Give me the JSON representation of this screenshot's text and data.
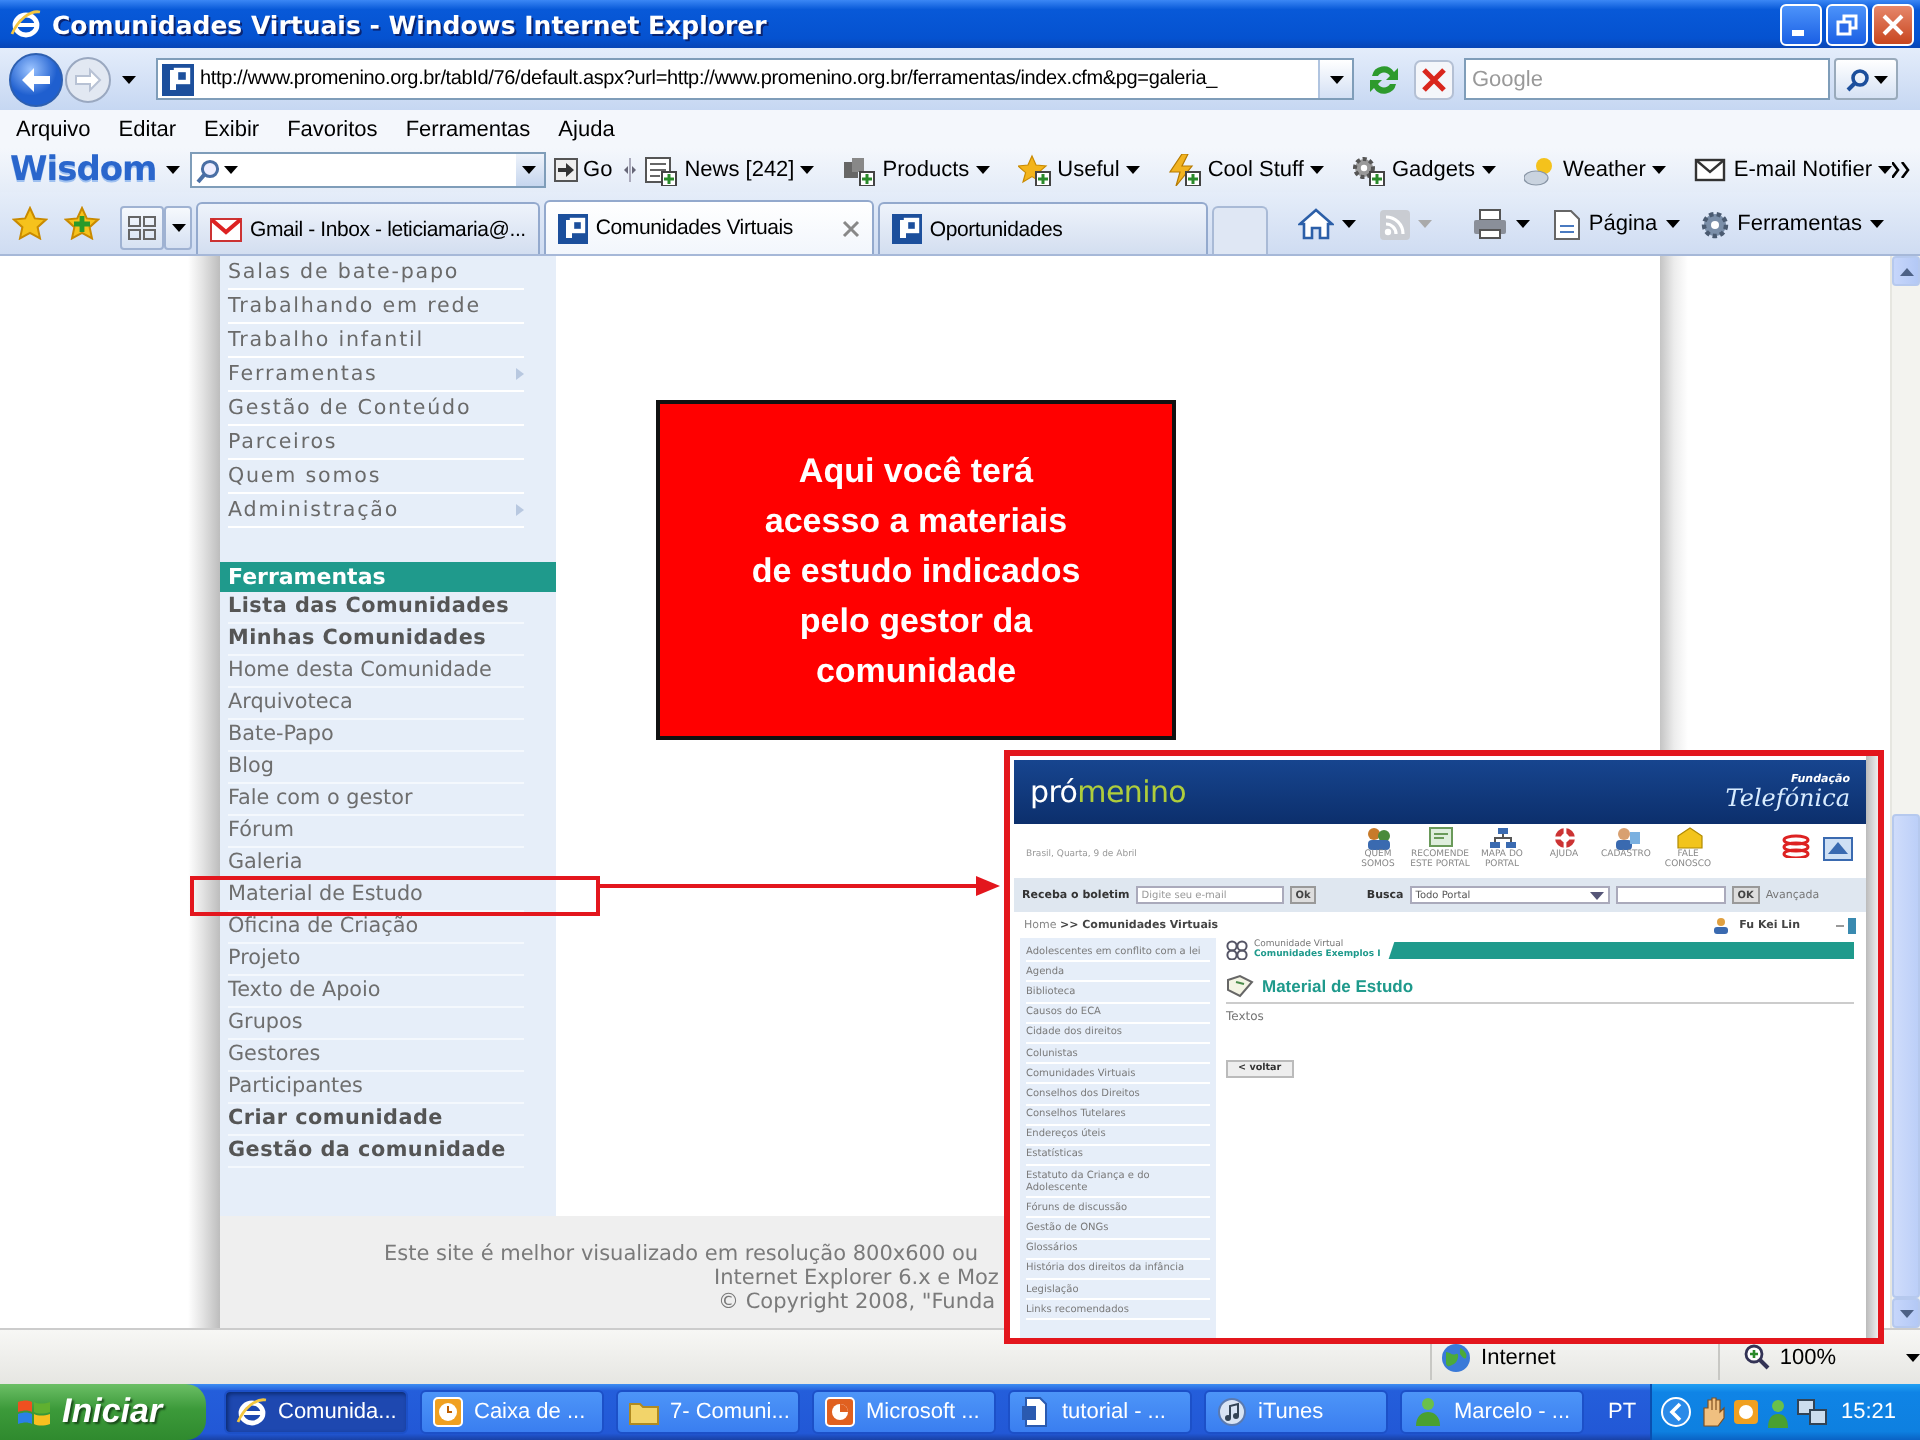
{
  "window": {
    "title": "Comunidades Virtuais - Windows Internet Explorer"
  },
  "address_bar": {
    "url": "http://www.promenino.org.br/tabId/76/default.aspx?url=http://www.promenino.org.br/ferramentas/index.cfm&pg=galeria_",
    "search_placeholder": "Google"
  },
  "menu_bar": [
    "Arquivo",
    "Editar",
    "Exibir",
    "Favoritos",
    "Ferramentas",
    "Ajuda"
  ],
  "toolbar": {
    "brand": "Wisdom",
    "go": "Go",
    "items": [
      "News [242]",
      "Products",
      "Useful",
      "Cool Stuff",
      "Gadgets",
      "Weather",
      "E-mail Notifier"
    ]
  },
  "tabs": [
    {
      "label": "Gmail - Inbox - leticiamaria@...",
      "selected": false
    },
    {
      "label": "Comunidades Virtuais",
      "selected": true
    },
    {
      "label": "Oportunidades",
      "selected": false
    }
  ],
  "command_bar": [
    "Página",
    "Ferramentas"
  ],
  "page": {
    "sidebar_links": [
      {
        "label": "Salas de bate-papo",
        "submenu": false
      },
      {
        "label": "Trabalhando em rede",
        "submenu": false
      },
      {
        "label": "Trabalho infantil",
        "submenu": false
      },
      {
        "label": "Ferramentas",
        "submenu": true
      },
      {
        "label": "Gestão de Conteúdo",
        "submenu": false
      },
      {
        "label": "Parceiros",
        "submenu": false
      },
      {
        "label": "Quem somos",
        "submenu": false
      },
      {
        "label": "Administração",
        "submenu": true
      }
    ],
    "section": {
      "title": "Ferramentas",
      "items": [
        {
          "label": "Lista das Comunidades",
          "bold": true,
          "highlighted": false
        },
        {
          "label": "Minhas Comunidades",
          "bold": true,
          "highlighted": false
        },
        {
          "label": "Home desta Comunidade",
          "bold": false,
          "highlighted": false
        },
        {
          "label": "Arquivoteca",
          "bold": false,
          "highlighted": false
        },
        {
          "label": "Bate-Papo",
          "bold": false,
          "highlighted": false
        },
        {
          "label": "Blog",
          "bold": false,
          "highlighted": false
        },
        {
          "label": "Fale com o gestor",
          "bold": false,
          "highlighted": false
        },
        {
          "label": "Fórum",
          "bold": false,
          "highlighted": false
        },
        {
          "label": "Galeria",
          "bold": false,
          "highlighted": false
        },
        {
          "label": "Material de Estudo",
          "bold": false,
          "highlighted": true
        },
        {
          "label": "Oficina de Criação",
          "bold": false,
          "highlighted": false
        },
        {
          "label": "Projeto",
          "bold": false,
          "highlighted": false
        },
        {
          "label": "Texto de Apoio",
          "bold": false,
          "highlighted": false
        },
        {
          "label": "Grupos",
          "bold": false,
          "highlighted": false
        },
        {
          "label": "Gestores",
          "bold": false,
          "highlighted": false
        },
        {
          "label": "Participantes",
          "bold": false,
          "highlighted": false
        },
        {
          "label": "Criar comunidade",
          "bold": true,
          "highlighted": false
        },
        {
          "label": "Gestão da comunidade",
          "bold": true,
          "highlighted": false
        }
      ]
    },
    "footer": [
      "Este site é melhor visualizado em resolução 800x600 ou",
      "Internet Explorer 6.x e Moz",
      "© Copyright 2008, \"Funda"
    ]
  },
  "callout": {
    "text": "Aqui você terá acesso a materiais de estudo indicados pelo gestor da comunidade"
  },
  "inset": {
    "logo": {
      "first": "pró",
      "second": "menino"
    },
    "sponsor": {
      "caption": "Fundação",
      "name": "Telefónica"
    },
    "date": "Brasil, Quarta, 9 de Abril",
    "icons": [
      "QUEM SOMOS",
      "RECOMENDE ESTE PORTAL",
      "MAPA DO PORTAL",
      "AJUDA",
      "CADASTRO",
      "FALE CONOSCO"
    ],
    "newsletter": {
      "label": "Receba o boletim",
      "placeholder": "Digite seu e-mail",
      "button": "Ok"
    },
    "search": {
      "label": "Busca",
      "value": "Todo Portal",
      "button": "OK",
      "advanced": "Avançada"
    },
    "breadcrumb": "Home **>> Comunidades Virtuais**",
    "user": "Fu Kei Lin",
    "sidebar": [
      "Adolescentes em conflito com a lei",
      "Agenda",
      "Biblioteca",
      "Causos do ECA",
      "Cidade dos direitos",
      "Colunistas",
      "Comunidades Virtuais",
      "Conselhos dos Direitos",
      "Conselhos Tutelares",
      "Endereços úteis",
      "Estatísticas",
      "Estatuto da Criança e do Adolescente",
      "Fóruns de discussão",
      "Gestão de ONGs",
      "Glossários",
      "História dos direitos da infância",
      "Legislação",
      "Links recomendados"
    ],
    "community": {
      "label": "Comunidade Virtual",
      "name": "Comunidades Exemplos I"
    },
    "heading": "Material de Estudo",
    "subheading": "Textos",
    "back_button": "< voltar"
  },
  "status_bar": {
    "zone": "Internet",
    "zoom": "100%"
  },
  "taskbar": {
    "start": "Iniciar",
    "tasks": [
      {
        "label": "Comunida...",
        "selected": true
      },
      {
        "label": "Caixa de ...",
        "selected": false
      },
      {
        "label": "7- Comuni...",
        "selected": false
      },
      {
        "label": "Microsoft ...",
        "selected": false
      },
      {
        "label": "tutorial - ...",
        "selected": false
      },
      {
        "label": "iTunes",
        "selected": false
      },
      {
        "label": "Marcelo - ...",
        "selected": false
      }
    ],
    "language": "PT",
    "clock": "15:21"
  }
}
